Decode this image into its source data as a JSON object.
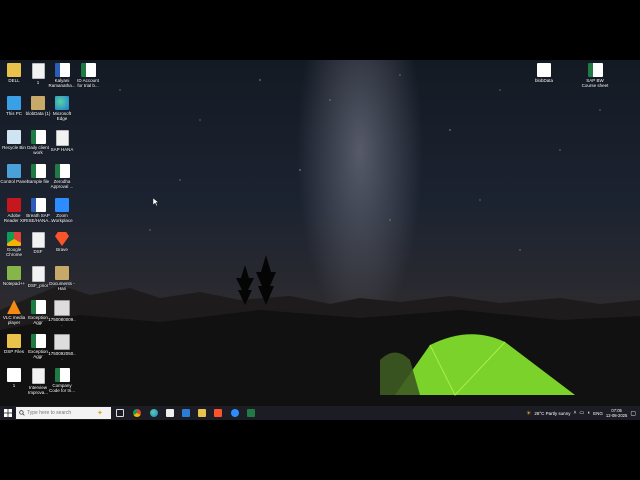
{
  "desktop": {
    "icons": [
      {
        "label": "DELL",
        "glyph": "folder"
      },
      {
        "label": "1",
        "glyph": "file"
      },
      {
        "label": "Kalyani Ramanatha...",
        "glyph": "word"
      },
      {
        "label": "ID Account for trial b...",
        "glyph": "excel"
      },
      {
        "label": "This PC",
        "glyph": "pc"
      },
      {
        "label": "blobData (1)",
        "glyph": "zip"
      },
      {
        "label": "Microsoft Edge",
        "glyph": "edge"
      },
      {
        "label": "Recycle Bin",
        "glyph": "bin"
      },
      {
        "label": "Daily client work",
        "glyph": "excel"
      },
      {
        "label": "SAP HANA",
        "glyph": "file"
      },
      {
        "label": "Control Panel",
        "glyph": "cp"
      },
      {
        "label": "Sample file",
        "glyph": "excel"
      },
      {
        "label": "Zerodha Approval ...",
        "glyph": "excel"
      },
      {
        "label": "Adobe Reader XI",
        "glyph": "pdf"
      },
      {
        "label": "Breath SAP RISE/HANA...",
        "glyph": "word"
      },
      {
        "label": "Zoom Workplace",
        "glyph": "zoom"
      },
      {
        "label": "Google Chrome",
        "glyph": "chrome"
      },
      {
        "label": "DSF",
        "glyph": "file"
      },
      {
        "label": "Brave",
        "glyph": "brave"
      },
      {
        "label": "Notepad++",
        "glyph": "npp"
      },
      {
        "label": "DSF_prior",
        "glyph": "file"
      },
      {
        "label": "Documents - Hari",
        "glyph": "zip"
      },
      {
        "label": "VLC media player",
        "glyph": "vlc"
      },
      {
        "label": "Exception Aggr",
        "glyph": "excel"
      },
      {
        "label": "1750080009...",
        "glyph": "img"
      },
      {
        "label": "DSP Files",
        "glyph": "folder"
      },
      {
        "label": "Exception Aggr",
        "glyph": "excel"
      },
      {
        "label": "1750092050...",
        "glyph": "img"
      },
      {
        "label": "1",
        "glyph": "blank"
      },
      {
        "label": "Interview Improva...",
        "glyph": "file"
      },
      {
        "label": "Company Code for tri...",
        "glyph": "excel"
      },
      {
        "label": "blobData",
        "glyph": "blank"
      },
      {
        "label": "SAP BW Course sheet",
        "glyph": "excel"
      }
    ]
  },
  "taskbar": {
    "search_placeholder": "Type here to search",
    "apps": [
      "task-view",
      "edge",
      "chrome",
      "file-explorer",
      "mail",
      "brave",
      "store",
      "zoom",
      "excel"
    ],
    "weather": "28°C  Partly sunny",
    "language": "ENG",
    "time": "07:05",
    "date": "12-08-2025"
  },
  "colors": {
    "taskbar_bg": "#1c1c24",
    "excel": "#1f7a43",
    "word": "#2b5cb8"
  }
}
